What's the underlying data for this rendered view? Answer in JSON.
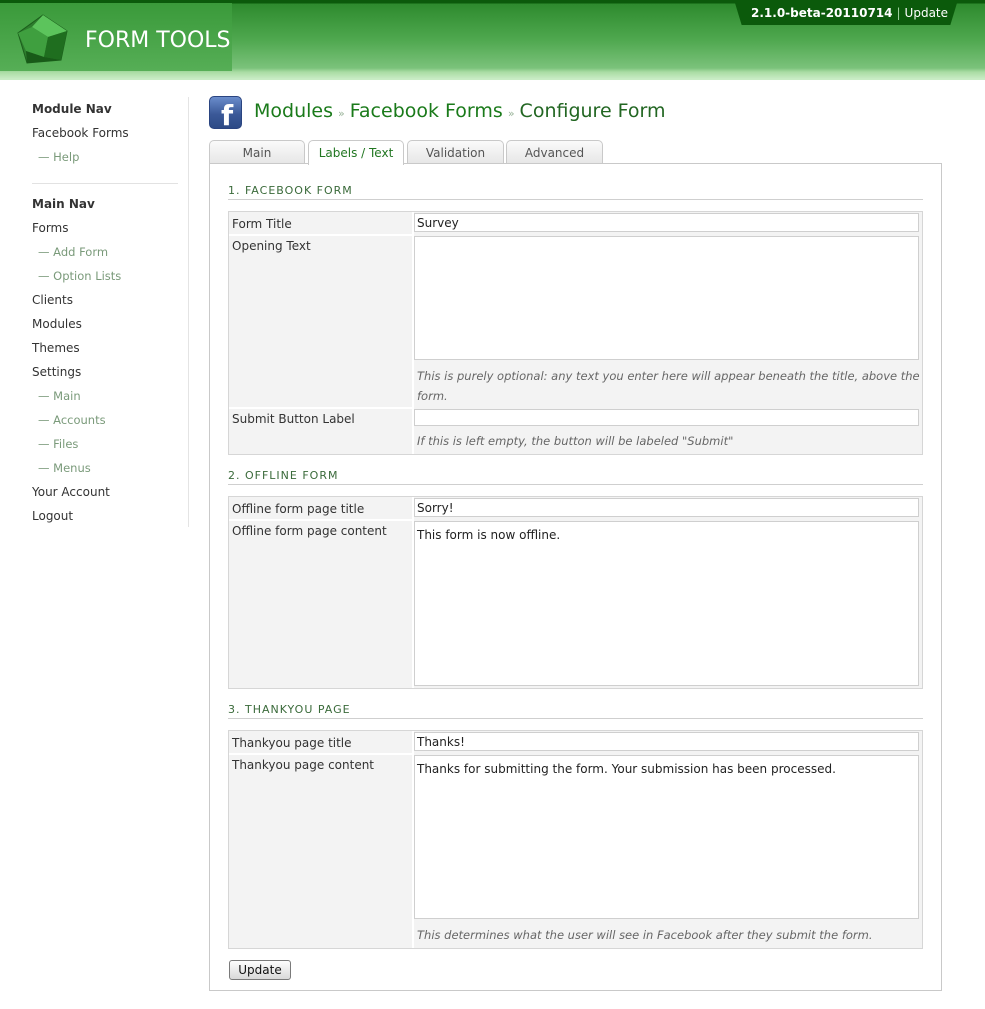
{
  "header": {
    "logo_text": "FORM TOOLS",
    "version": "2.1.0-beta-20110714",
    "separator": "|",
    "update_link": "Update"
  },
  "module_nav": {
    "heading": "Module Nav",
    "items": [
      {
        "label": "Facebook Forms"
      },
      {
        "label": "— Help"
      }
    ]
  },
  "main_nav": {
    "heading": "Main Nav",
    "forms": "Forms",
    "add_form": "— Add Form",
    "option_lists": "— Option Lists",
    "clients": "Clients",
    "modules": "Modules",
    "themes": "Themes",
    "settings": "Settings",
    "settings_main": "— Main",
    "settings_accounts": "— Accounts",
    "settings_files": "— Files",
    "settings_menus": "— Menus",
    "your_account": "Your Account",
    "logout": "Logout"
  },
  "title": {
    "icon_letter": "f",
    "crumb1": "Modules",
    "crumb2": "Facebook Forms",
    "current": "Configure Form",
    "arrow": "»"
  },
  "tabs": {
    "main": "Main",
    "labels_text": "Labels / Text",
    "validation": "Validation",
    "advanced": "Advanced",
    "active": "Labels / Text"
  },
  "section1": {
    "title": "1. FACEBOOK FORM",
    "form_title_label": "Form Title",
    "form_title_value": "Survey",
    "opening_text_label": "Opening Text",
    "opening_text_value": "",
    "opening_text_hint": "This is purely optional: any text you enter here will appear beneath the title, above the form.",
    "submit_label": "Submit Button Label",
    "submit_value": "",
    "submit_hint": "If this is left empty, the button will be labeled \"Submit\""
  },
  "section2": {
    "title": "2. OFFLINE FORM",
    "page_title_label": "Offline form page title",
    "page_title_value": "Sorry!",
    "page_content_label": "Offline form page content",
    "page_content_value": "This form is now offline."
  },
  "section3": {
    "title": "3. THANKYOU PAGE",
    "page_title_label": "Thankyou page title",
    "page_title_value": "Thanks!",
    "page_content_label": "Thankyou page content",
    "page_content_value": "Thanks for submitting the form. Your submission has been processed.",
    "page_content_hint": "This determines what the user will see in Facebook after they submit the form."
  },
  "buttons": {
    "update": "Update"
  },
  "colors": {
    "brand_green": "#1a7a1a",
    "header_dark": "#0b5a0b",
    "facebook_blue": "#3b5998"
  }
}
